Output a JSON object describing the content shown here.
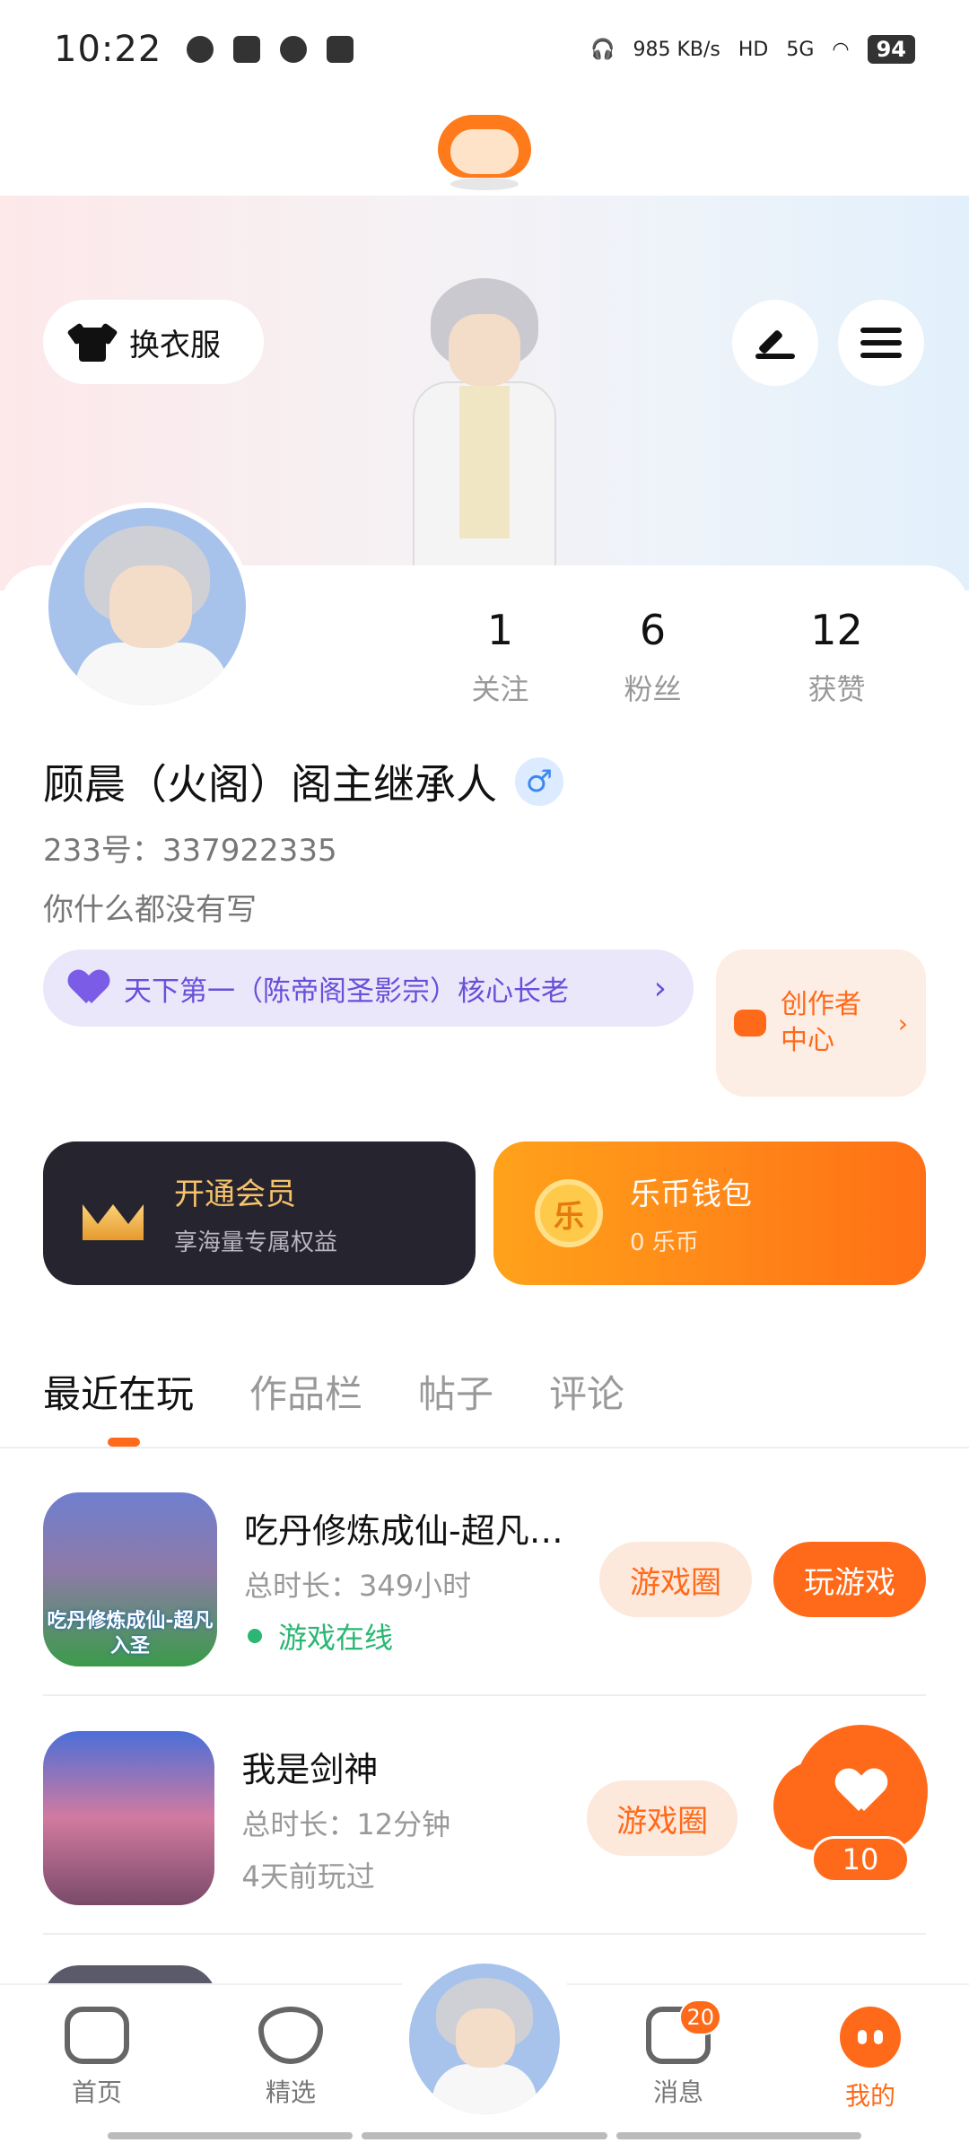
{
  "status_bar": {
    "time": "10:22",
    "net_speed_value": "985",
    "net_speed_unit": "KB/s",
    "hd": "HD",
    "signal": "5G",
    "battery": "94"
  },
  "profile": {
    "outfit_label": "换衣服",
    "stats": [
      {
        "num": "1",
        "label": "关注"
      },
      {
        "num": "6",
        "label": "粉丝"
      },
      {
        "num": "12",
        "label": "获赞"
      }
    ],
    "username": "顾晨（火阁）阁主继承人",
    "gender_symbol": "♂",
    "uid": "233号：337922335",
    "bio": "你什么都没有写",
    "title_chip": "天下第一（陈帝阁圣影宗）核心长老",
    "creator_center": "创作者中心"
  },
  "cards": {
    "vip_title": "开通会员",
    "vip_sub": "享海量专属权益",
    "wallet_title": "乐币钱包",
    "wallet_sub": "0 乐币",
    "coin_char": "乐"
  },
  "tabs": [
    "最近在玩",
    "作品栏",
    "帖子",
    "评论"
  ],
  "games": [
    {
      "name": "吃丹修炼成仙-超凡入圣",
      "duration": "总时长：349小时",
      "status": "游戏在线",
      "thumb_caption": "吃丹修炼成仙-超凡入圣",
      "circle_btn": "游戏圈",
      "play_btn": "玩游戏"
    },
    {
      "name": "我是剑神",
      "duration": "总时长：12分钟",
      "status": "4天前玩过",
      "circle_btn": "游戏圈"
    }
  ],
  "like_float": {
    "count": "10"
  },
  "bottom_nav": {
    "home": "首页",
    "select": "精选",
    "messages": "消息",
    "messages_badge": "20",
    "me": "我的"
  },
  "colors": {
    "accent": "#ff6a1a",
    "purple": "#6a4fd8",
    "online": "#2bb673"
  }
}
